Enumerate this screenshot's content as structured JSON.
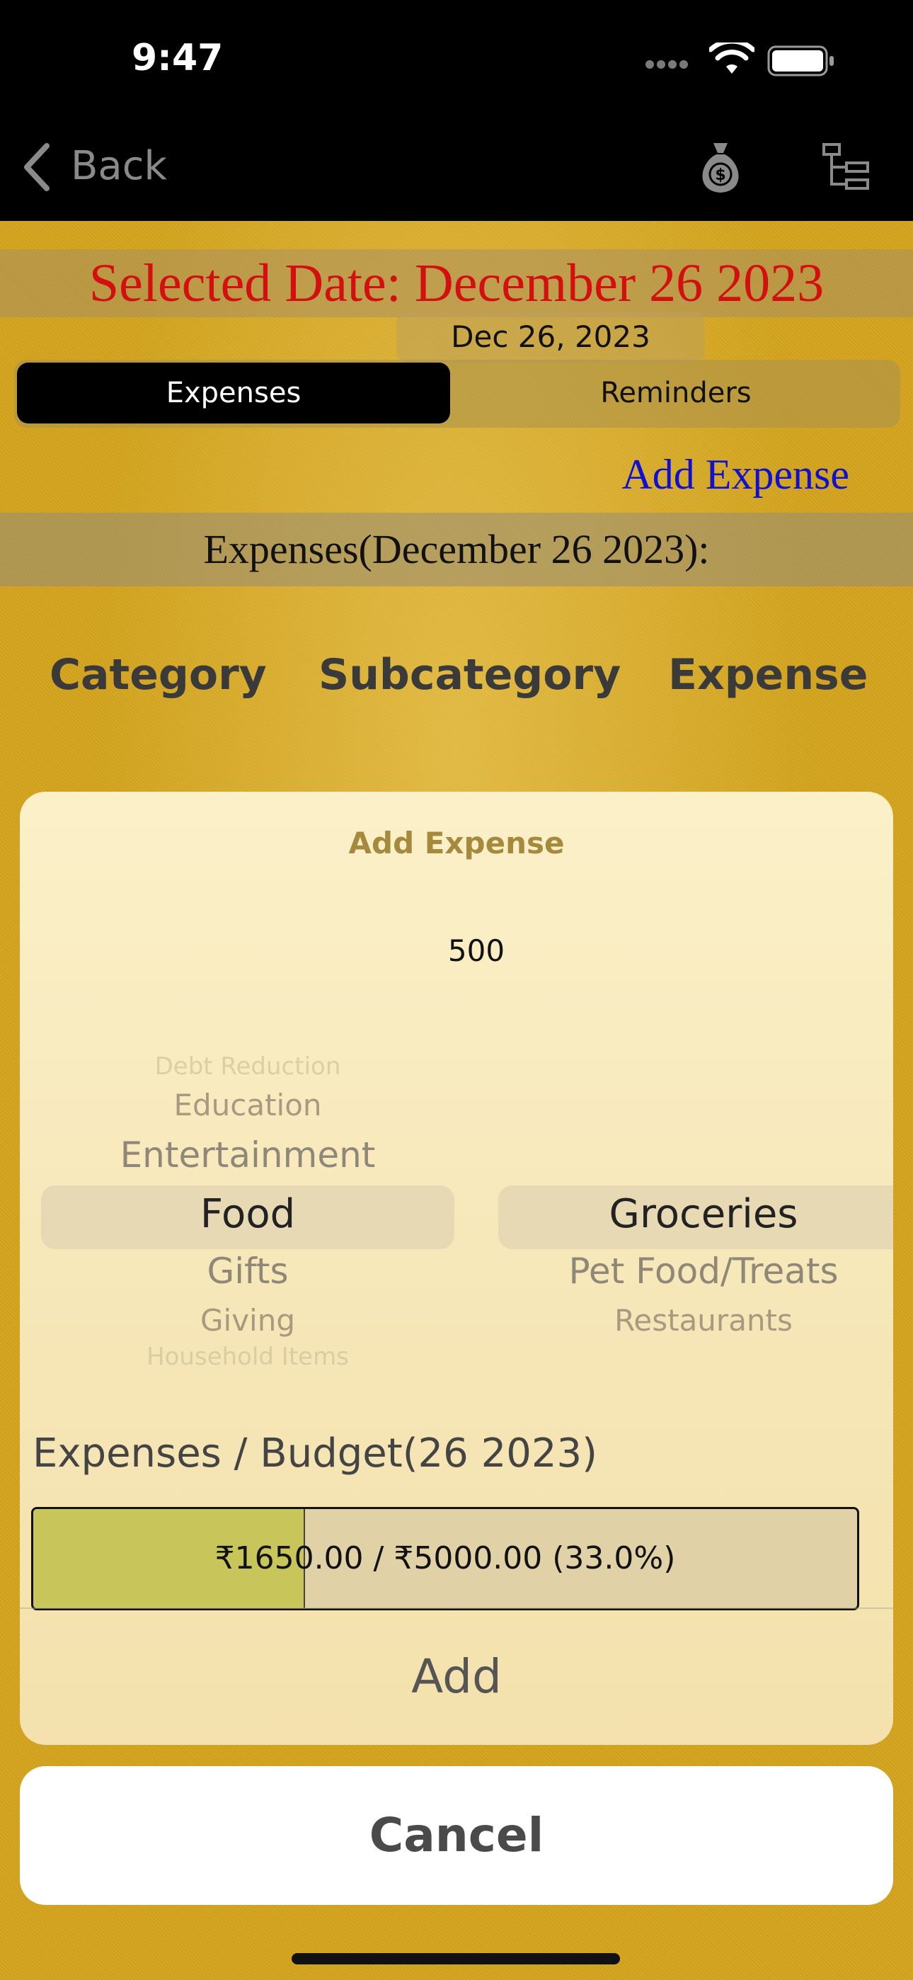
{
  "status_bar": {
    "time": "9:47"
  },
  "nav": {
    "back_label": "Back",
    "icons": [
      "money-bag-icon",
      "hierarchy-icon"
    ]
  },
  "date_section": {
    "selected_date": "Selected Date: December 26 2023",
    "date_pill": "Dec 26, 2023"
  },
  "tabs": [
    {
      "label": "Expenses",
      "selected": true
    },
    {
      "label": "Reminders",
      "selected": false
    }
  ],
  "add_expense_link": "Add Expense",
  "list_header": "Expenses(December 26 2023):",
  "columns": [
    "Category",
    "Subcategory",
    "Expense"
  ],
  "sheet": {
    "title": "Add Expense",
    "amount": "500",
    "category_picker": {
      "items": [
        "Debt Reduction",
        "Education",
        "Entertainment",
        "Food",
        "Gifts",
        "Giving",
        "Household Items"
      ],
      "selected": "Food"
    },
    "subcategory_picker": {
      "items": [
        "Groceries",
        "Pet Food/Treats",
        "Restaurants"
      ],
      "selected": "Groceries"
    },
    "budget_label": "Expenses / Budget(26 2023)",
    "budget_text": "₹1650.00 / ₹5000.00 (33.0%)",
    "budget_fraction": 0.33,
    "add_label": "Add"
  },
  "cancel_label": "Cancel",
  "colors": {
    "background": "#d4a41e",
    "selected_date": "#d40f0f",
    "link": "#1010d0",
    "budget_fill": "#c8c65a"
  }
}
